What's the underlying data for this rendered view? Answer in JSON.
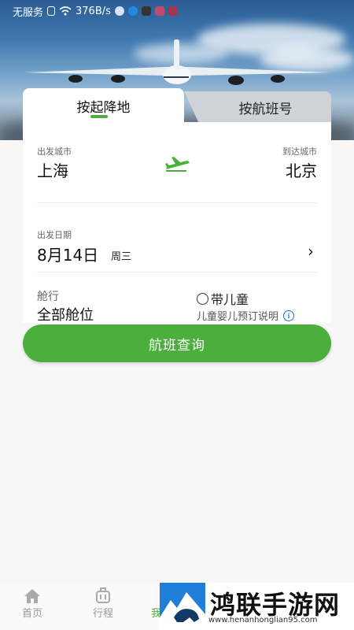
{
  "status_bar": {
    "carrier": "无服务",
    "speed": "376B/s"
  },
  "tabs": {
    "active": "按起降地",
    "inactive": "按航班号"
  },
  "route": {
    "from_label": "出发城市",
    "from_city": "上海",
    "to_label": "到达城市",
    "to_city": "北京",
    "swap_icon": "plane-icon"
  },
  "date": {
    "label": "出发日期",
    "value": "8月14日",
    "weekday": "周三"
  },
  "cabin": {
    "label": "舱行",
    "value": "全部舱位"
  },
  "child": {
    "label": "带儿童",
    "note": "儿童婴儿预订说明"
  },
  "search_button": "航班查询",
  "bottom_nav": {
    "home": "首页",
    "trip": "行程",
    "third_partial": "我"
  },
  "watermark": {
    "title": "鸿联手游网",
    "url": "www.henanhonglian95.com"
  },
  "colors": {
    "accent": "#4caf3d",
    "info": "#1e6fd0"
  }
}
